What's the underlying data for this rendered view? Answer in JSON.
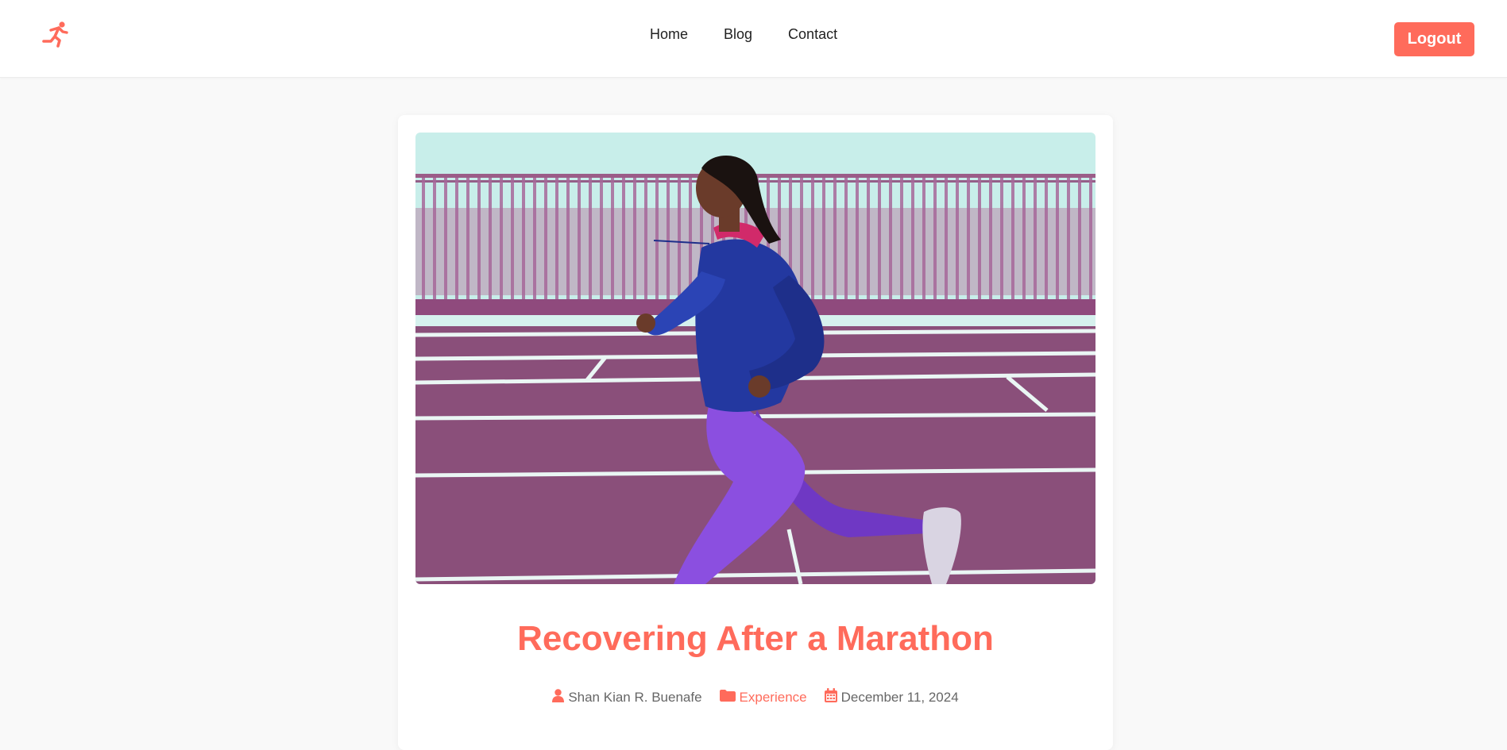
{
  "nav": {
    "logo_icon": "running-person-icon",
    "links": [
      "Home",
      "Blog",
      "Contact"
    ],
    "logout_label": "Logout"
  },
  "post": {
    "image_alt": "Woman running on a purple track",
    "title": "Recovering After a Marathon",
    "author": "Shan Kian R. Buenafe",
    "category": "Experience",
    "date": "December 11, 2024"
  },
  "colors": {
    "accent": "#ff6b5b",
    "track": "#8a4f7a",
    "sky": "#c8eeea",
    "jacket": "#2338a0",
    "leggings": "#8b4fe0"
  }
}
